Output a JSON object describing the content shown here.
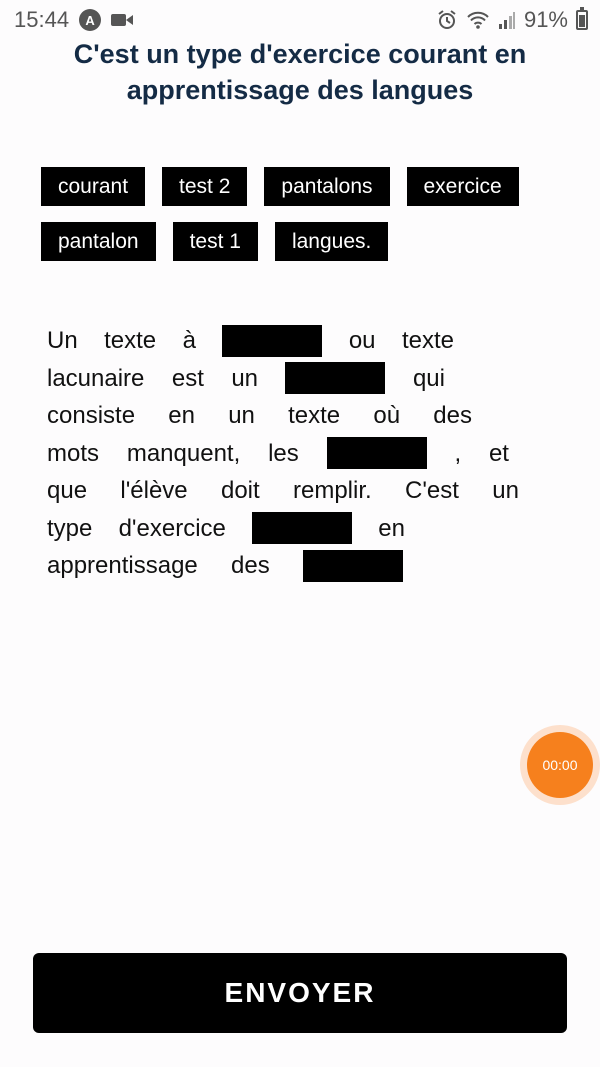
{
  "status_bar": {
    "time": "15:44",
    "battery": "91%",
    "icons": [
      "a-icon",
      "video-icon",
      "alarm-icon",
      "wifi-icon",
      "signal-icon",
      "battery-icon"
    ]
  },
  "title": "C'est un type d'exercice courant en apprentissage des langues",
  "chips": [
    [
      "courant",
      "test 2",
      "pantalons",
      "exercice"
    ],
    [
      "pantalon",
      "test 1",
      "langues."
    ]
  ],
  "paragraph": {
    "l1": [
      "Un",
      "texte",
      "à",
      "ou",
      "texte"
    ],
    "l2": [
      "lacunaire",
      "est",
      "un",
      "qui"
    ],
    "l3": [
      "consiste",
      "en",
      "un",
      "texte",
      "où",
      "des"
    ],
    "l4": [
      "mots",
      "manquent,",
      "les",
      ",",
      "et"
    ],
    "l5": [
      "que",
      "l'élève",
      "doit",
      "remplir.",
      "C'est",
      "un"
    ],
    "l6": [
      "type",
      "d'exercice",
      "en"
    ],
    "l7": [
      "apprentissage",
      "des"
    ]
  },
  "timer": "00:00",
  "send_button": "ENVOYER",
  "colors": {
    "title": "#142b45",
    "timer": "#f6801d",
    "chip_bg": "#000000"
  }
}
